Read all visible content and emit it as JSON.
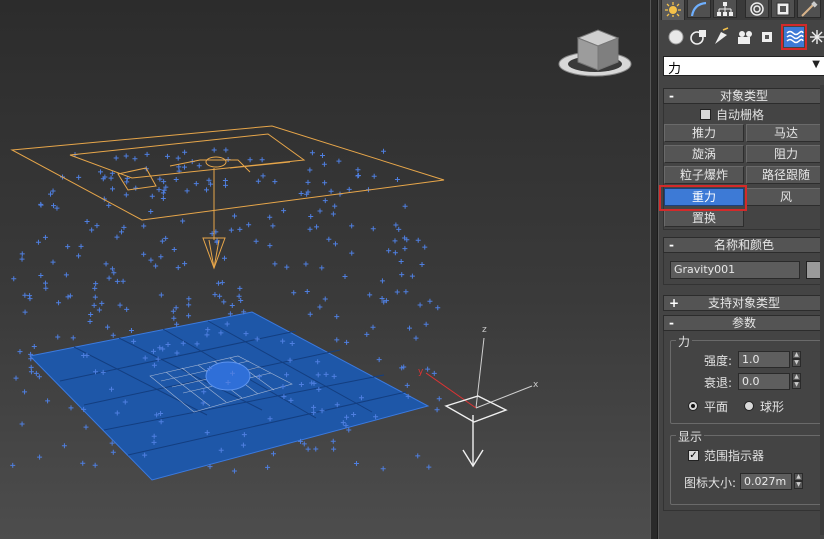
{
  "panel": {
    "category_dropdown": "力",
    "object_type": {
      "title": "对象类型",
      "collapse_sign": "-",
      "autogrid_label": "自动栅格",
      "autogrid_checked": false,
      "buttons": [
        "推力",
        "马达",
        "旋涡",
        "阻力",
        "粒子爆炸",
        "路径跟随",
        "重力",
        "风",
        "置换"
      ],
      "active_button": "重力"
    },
    "name_color": {
      "title": "名称和颜色",
      "collapse_sign": "-",
      "object_name": "Gravity001",
      "swatch_color": "#9a9a9a"
    },
    "supported_types": {
      "title": "支持对象类型",
      "collapse_sign": "+"
    },
    "parameters": {
      "title": "参数",
      "collapse_sign": "-",
      "force_group": {
        "title": "力",
        "strength_label": "强度:",
        "strength_value": "1.0",
        "decay_label": "衰退:",
        "decay_value": "0.0",
        "radio_planar": "平面",
        "radio_spherical": "球形",
        "selected_radio": "平面"
      },
      "display_group": {
        "title": "显示",
        "range_indicator_label": "范围指示器",
        "range_indicator_checked": true,
        "icon_size_label": "图标大小:",
        "icon_size_value": "0.027m"
      }
    }
  },
  "viewport": {
    "gizmo_axes": {
      "x": "x",
      "y": "y",
      "z": "z"
    },
    "gravity_color": "#e7a64a",
    "particle_color": "#4f7fe0",
    "plane_color": "#1e57a8",
    "accent_red": "#d32a2a",
    "accent_blue": "#3d7ad6"
  },
  "icons": {
    "tabs": [
      "create-icon",
      "modify-icon",
      "hierarchy-icon",
      "motion-icon",
      "display-icon",
      "utilities-icon"
    ],
    "categories": [
      "geometry-icon",
      "shapes-icon",
      "lights-icon",
      "cameras-icon",
      "helpers-icon",
      "space-warps-icon",
      "systems-icon"
    ]
  }
}
